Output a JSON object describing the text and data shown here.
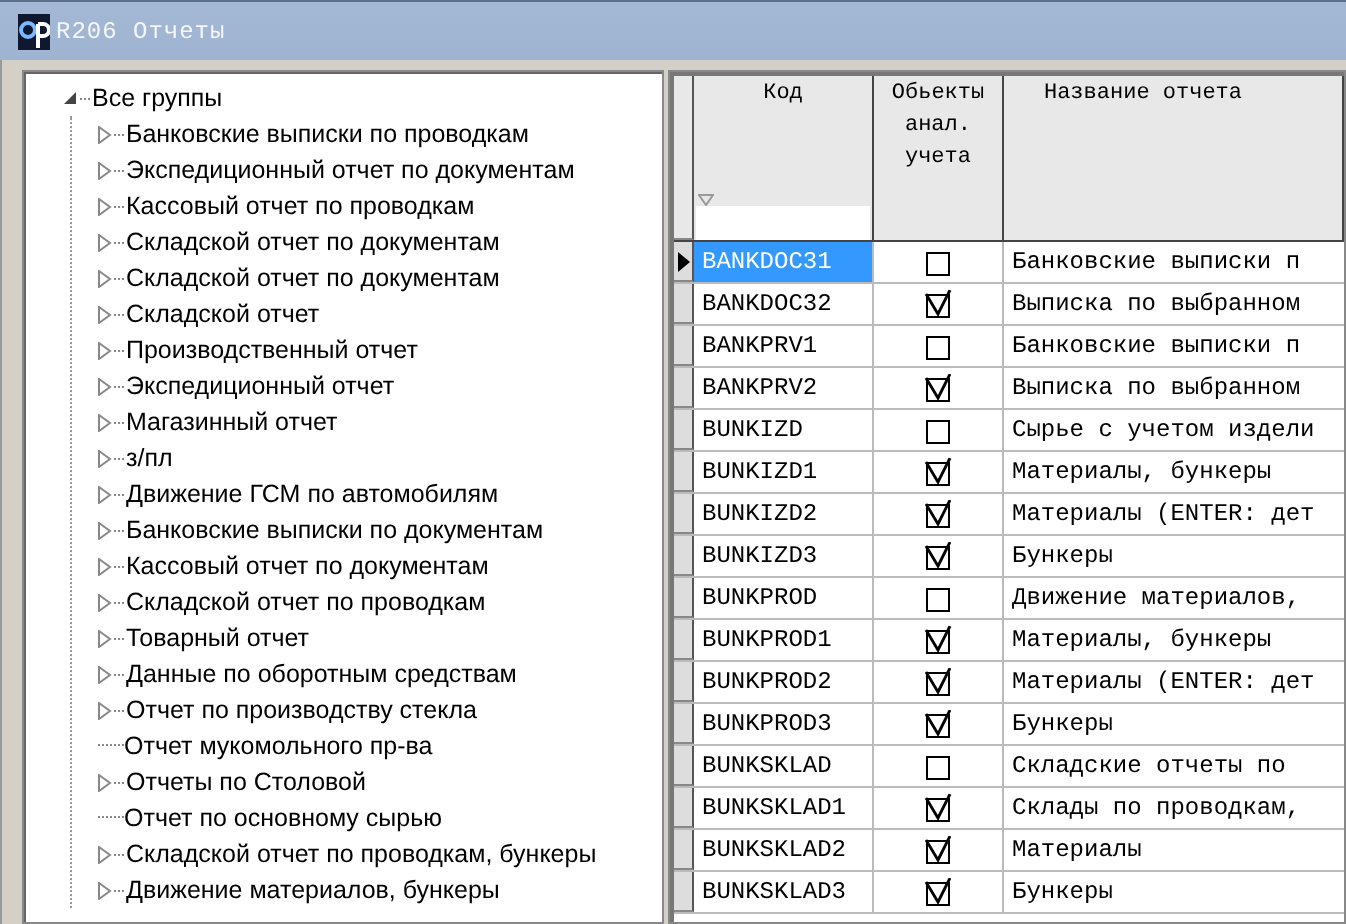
{
  "window": {
    "title": "R206  Отчеты"
  },
  "tree": {
    "label": "Все группы",
    "expanded": true,
    "children": [
      {
        "label": "Банковские выписки по проводкам",
        "expandable": true
      },
      {
        "label": "Экспедиционный отчет по документам",
        "expandable": true
      },
      {
        "label": "Кассовый отчет по проводкам",
        "expandable": true
      },
      {
        "label": "Складской отчет по документам",
        "expandable": true
      },
      {
        "label": "Складской отчет по документам",
        "expandable": true
      },
      {
        "label": "Складской отчет",
        "expandable": true
      },
      {
        "label": "Производственный отчет",
        "expandable": true
      },
      {
        "label": "Экспедиционный отчет",
        "expandable": true
      },
      {
        "label": "Магазинный отчет",
        "expandable": true
      },
      {
        "label": "з/пл",
        "expandable": true
      },
      {
        "label": "Движение ГСМ по автомобилям",
        "expandable": true
      },
      {
        "label": "Банковские выписки по документам",
        "expandable": true
      },
      {
        "label": "Кассовый отчет по документам",
        "expandable": true
      },
      {
        "label": "Складской отчет по проводкам",
        "expandable": true
      },
      {
        "label": "Товарный отчет",
        "expandable": true
      },
      {
        "label": "Данные по оборотным средствам",
        "expandable": true
      },
      {
        "label": "Отчет по производству стекла",
        "expandable": true
      },
      {
        "label": "Отчет мукомольного пр-ва",
        "expandable": false
      },
      {
        "label": "Отчеты по Столовой",
        "expandable": true
      },
      {
        "label": "Отчет по основному сырью",
        "expandable": false
      },
      {
        "label": "Складской отчет по проводкам, бункеры",
        "expandable": true
      },
      {
        "label": "Движение материалов, бункеры",
        "expandable": true
      }
    ]
  },
  "table": {
    "columns": [
      "Код",
      "Обьекты анал. учета",
      "Название отчета"
    ],
    "rows": [
      {
        "code": "BANKDOC31",
        "checked": false,
        "name": "Банковские выписки п",
        "selected": true
      },
      {
        "code": "BANKDOC32",
        "checked": true,
        "name": "Выписка по выбранном",
        "selected": false
      },
      {
        "code": "BANKPRV1",
        "checked": false,
        "name": "Банковские выписки п",
        "selected": false
      },
      {
        "code": "BANKPRV2",
        "checked": true,
        "name": "Выписка по выбранном",
        "selected": false
      },
      {
        "code": "BUNKIZD",
        "checked": false,
        "name": "Сырье с учетом издели",
        "selected": false
      },
      {
        "code": "BUNKIZD1",
        "checked": true,
        "name": "Материалы, бункеры",
        "selected": false
      },
      {
        "code": "BUNKIZD2",
        "checked": true,
        "name": "Материалы (ENTER: дет",
        "selected": false
      },
      {
        "code": "BUNKIZD3",
        "checked": true,
        "name": "Бункеры",
        "selected": false
      },
      {
        "code": "BUNKPROD",
        "checked": false,
        "name": "Движение материалов,",
        "selected": false
      },
      {
        "code": "BUNKPROD1",
        "checked": true,
        "name": "Материалы, бункеры",
        "selected": false
      },
      {
        "code": "BUNKPROD2",
        "checked": true,
        "name": "Материалы (ENTER: дет",
        "selected": false
      },
      {
        "code": "BUNKPROD3",
        "checked": true,
        "name": "Бункеры",
        "selected": false
      },
      {
        "code": "BUNKSKLAD",
        "checked": false,
        "name": "Складские отчеты по",
        "selected": false
      },
      {
        "code": "BUNKSKLAD1",
        "checked": true,
        "name": "Склады по проводкам,",
        "selected": false
      },
      {
        "code": "BUNKSKLAD2",
        "checked": true,
        "name": "Материалы",
        "selected": false
      },
      {
        "code": "BUNKSKLAD3",
        "checked": true,
        "name": "Бункеры",
        "selected": false
      }
    ]
  }
}
